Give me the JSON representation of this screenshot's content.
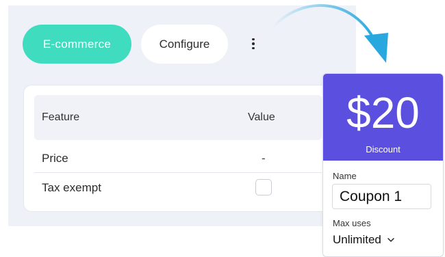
{
  "toolbar": {
    "primary_tab": "E-commerce",
    "secondary_tab": "Configure",
    "more_icon": "kebab-vertical-icon"
  },
  "table": {
    "headers": [
      "Feature",
      "Value"
    ],
    "rows": [
      {
        "feature": "Price",
        "value": "-"
      },
      {
        "feature": "Tax exempt",
        "value": "",
        "control": "checkbox",
        "checked": false
      }
    ]
  },
  "coupon": {
    "amount": "$20",
    "amount_caption": "Discount",
    "name_label": "Name",
    "name_value": "Coupon 1",
    "uses_label": "Max uses",
    "uses_value": "Unlimited",
    "uses_icon": "chevron-down-icon"
  },
  "colors": {
    "accent_teal": "#3fdcc0",
    "coupon_purple": "#5b4fe0",
    "arrow_blue": "#29a8e0",
    "panel_bg": "#eef1f7"
  }
}
